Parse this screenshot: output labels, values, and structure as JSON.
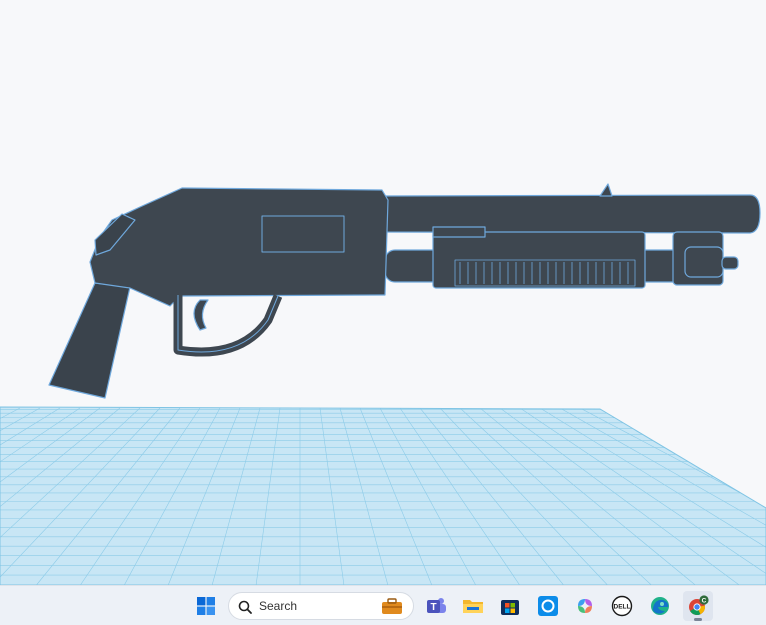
{
  "taskbar": {
    "search": {
      "label": "Search"
    },
    "pinned": [
      {
        "name": "start",
        "icon": "windows-logo-icon"
      },
      {
        "name": "teams",
        "icon": "teams-icon"
      },
      {
        "name": "file-explorer",
        "icon": "folder-icon"
      },
      {
        "name": "microsoft-store",
        "icon": "store-icon"
      },
      {
        "name": "cortana",
        "icon": "cortana-icon"
      },
      {
        "name": "copilot",
        "icon": "copilot-icon"
      },
      {
        "name": "dell",
        "icon": "dell-logo-icon",
        "text": "DELL"
      },
      {
        "name": "edge",
        "icon": "edge-icon"
      },
      {
        "name": "chrome",
        "icon": "chrome-icon",
        "badge": "C"
      }
    ]
  },
  "viewport": {
    "model": "shotgun",
    "colors": {
      "model": "#3e4750",
      "outline": "#6fa8dc",
      "workplane": "#c8e6f5",
      "grid": "#7fc4e4"
    }
  }
}
